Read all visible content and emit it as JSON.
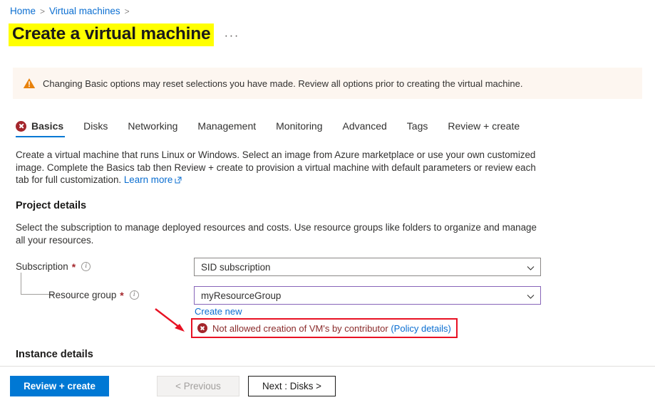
{
  "breadcrumb": {
    "items": [
      {
        "label": "Home"
      },
      {
        "label": "Virtual machines"
      }
    ],
    "separator": ">"
  },
  "header": {
    "title": "Create a virtual machine",
    "more_label": "···",
    "title_highlight_color": "#ffff00"
  },
  "warning": {
    "icon": "warning-triangle-icon",
    "text": "Changing Basic options may reset selections you have made. Review all options prior to creating the virtual machine.",
    "background": "#fdf6f0",
    "icon_color": "#e8820c"
  },
  "tabs": [
    {
      "label": "Basics",
      "active": true,
      "has_error": true
    },
    {
      "label": "Disks",
      "active": false,
      "has_error": false
    },
    {
      "label": "Networking",
      "active": false,
      "has_error": false
    },
    {
      "label": "Management",
      "active": false,
      "has_error": false
    },
    {
      "label": "Monitoring",
      "active": false,
      "has_error": false
    },
    {
      "label": "Advanced",
      "active": false,
      "has_error": false
    },
    {
      "label": "Tags",
      "active": false,
      "has_error": false
    },
    {
      "label": "Review + create",
      "active": false,
      "has_error": false
    }
  ],
  "intro": {
    "text": "Create a virtual machine that runs Linux or Windows. Select an image from Azure marketplace or use your own customized image. Complete the Basics tab then Review + create to provision a virtual machine with default parameters or review each tab for full customization.",
    "link_label": "Learn more"
  },
  "project_details": {
    "heading": "Project details",
    "description": "Select the subscription to manage deployed resources and costs. Use resource groups like folders to organize and manage all your resources.",
    "subscription": {
      "label": "Subscription",
      "required_marker": "*",
      "info_glyph": "i",
      "value": "SID subscription"
    },
    "resource_group": {
      "label": "Resource group",
      "required_marker": "*",
      "info_glyph": "i",
      "value": "myResourceGroup",
      "create_new_label": "Create new",
      "border_color": "#8764b8"
    },
    "error": {
      "message": "Not allowed creation of VM's by contributor",
      "link_label": "(Policy details)",
      "highlight_color": "#e81123",
      "text_color": "#8a2b2b"
    }
  },
  "instance_details": {
    "heading": "Instance details"
  },
  "footer": {
    "review_create_label": "Review + create",
    "previous_label": "< Previous",
    "next_label": "Next : Disks >",
    "primary_color": "#0078d4"
  }
}
